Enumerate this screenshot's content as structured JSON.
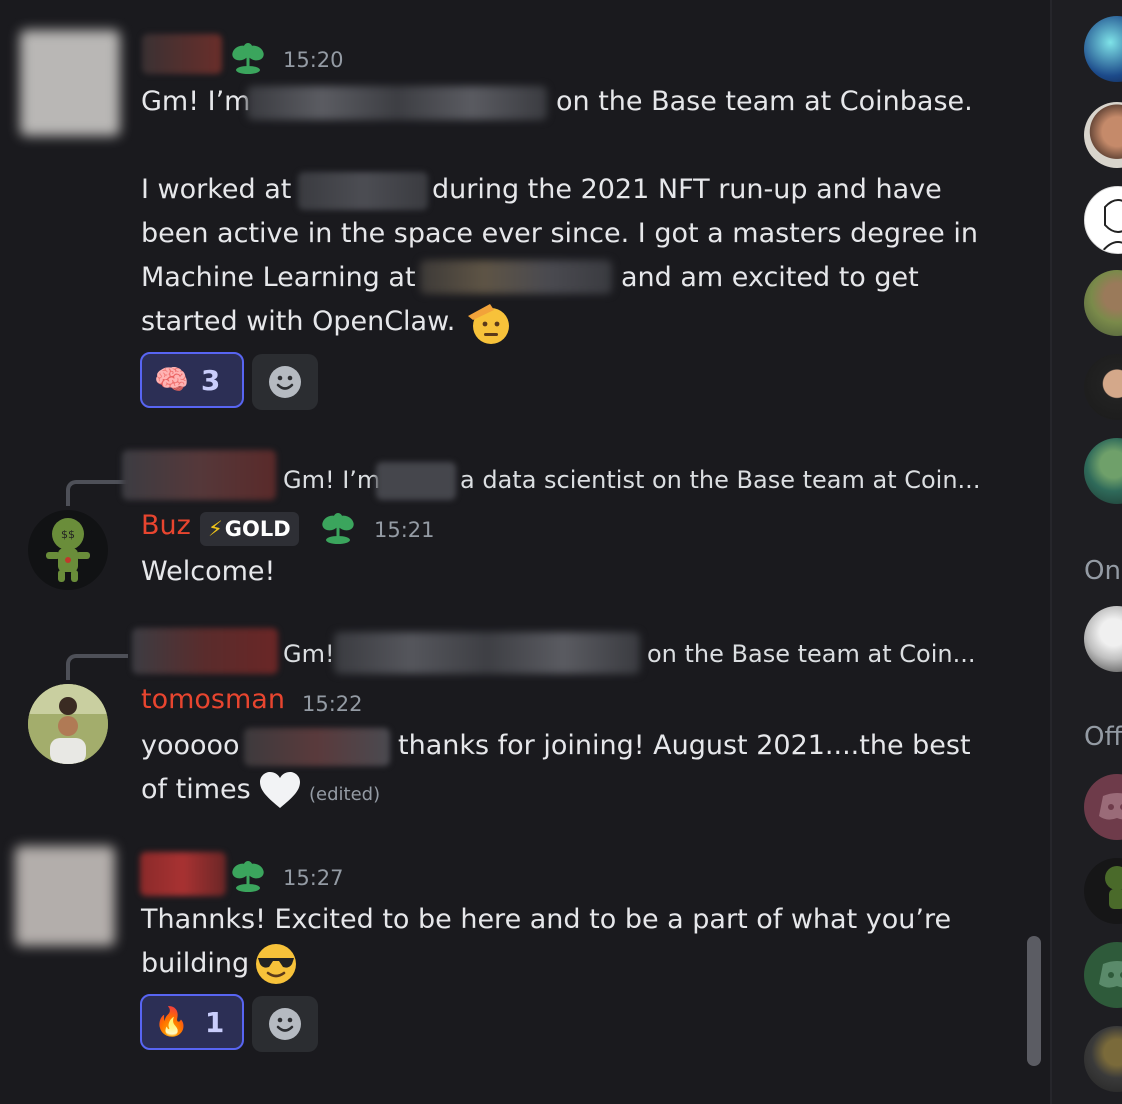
{
  "messages": [
    {
      "time": "15:20",
      "text_a": "Gm! I’m",
      "text_b": "on the Base team at Coinbase.",
      "text_c": "I worked at",
      "text_d": "during the 2021 NFT run-up and have",
      "text_e": "been active in the space ever since. I got a masters degree in",
      "text_f": "Machine Learning at",
      "text_g": "and am excited to get",
      "text_h": "started with OpenClaw.",
      "reaction_emoji": "🧠",
      "reaction_count": "3"
    },
    {
      "reply_a": "Gm! I’m",
      "reply_b": "a data scientist on the Base team at Coin...",
      "author": "Buz",
      "badge_icon": "⚡",
      "badge_text": "GOLD",
      "time": "15:21",
      "text": "Welcome!"
    },
    {
      "reply_a": "Gm!",
      "reply_b": "on the Base team at Coin...",
      "author": "tomosman",
      "time": "15:22",
      "text_a": "yooooo",
      "text_b": "thanks for joining! August 2021....the best",
      "text_c": "of times",
      "edited": "(edited)"
    },
    {
      "time": "15:27",
      "text_a": "Thannks! Excited to be here and to be a part of what you’re",
      "text_b": "building",
      "reaction_emoji": "🔥",
      "reaction_count": "1"
    }
  ],
  "sidebar": {
    "section_online": "Onl",
    "section_offline": "Off"
  },
  "colors": {
    "background": "#1a1a1e",
    "username_red": "#e8452f",
    "reaction_border": "#5865f2",
    "muted_text": "#949ba4"
  },
  "icons": {
    "server_boost": "sprout-icon",
    "add_reaction": "smile-icon",
    "heart": "white-heart-icon",
    "salute": "saluting-face-icon",
    "sunglasses": "sunglasses-face-icon"
  }
}
